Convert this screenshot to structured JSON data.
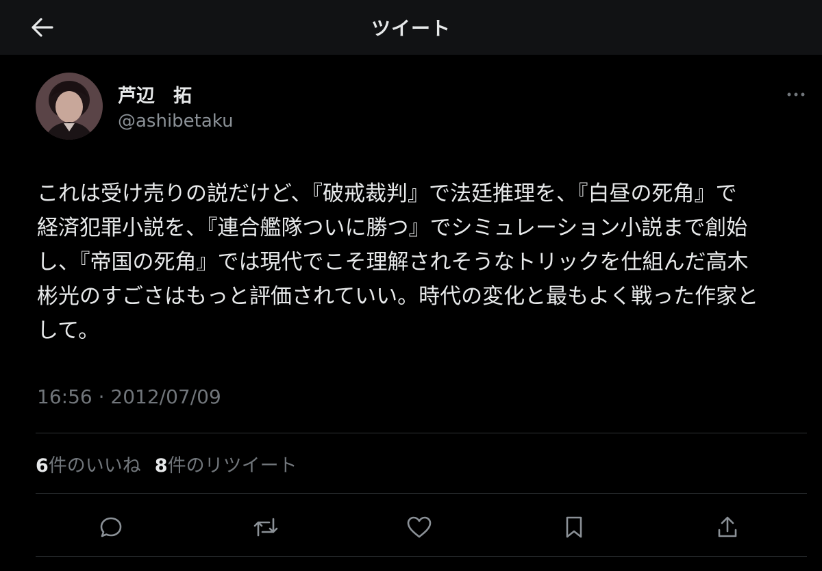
{
  "header": {
    "title": "ツイート",
    "back_icon": "arrow-left-icon"
  },
  "author": {
    "display_name": "芦辺　拓",
    "handle": "@ashibetaku",
    "avatar_icon": "avatar-photo"
  },
  "tweet": {
    "lines": [
      "これは受け売りの説だけど、『破戒裁判』で法廷推理を、『白昼の死角』で",
      "経済犯罪小説を、『連合艦隊ついに勝つ』でシミュレーション小説まで創始",
      "し、『帝国の死角』では現代でこそ理解されそうなトリックを仕組んだ高木",
      "彬光のすごさはもっと評価されていい。時代の変化と最もよく戦った作家と",
      "して。"
    ],
    "timestamp": "16:56 · 2012/07/09"
  },
  "stats": {
    "likes_count": "6",
    "likes_label": "件のいいね",
    "retweets_count": "8",
    "retweets_label": "件のリツイート"
  },
  "actions": [
    "reply-icon",
    "retweet-icon",
    "like-icon",
    "bookmark-icon",
    "share-icon"
  ],
  "colors": {
    "background": "#000000",
    "header_background": "#111214",
    "text": "#e7e9ea",
    "secondary_text": "#71767b",
    "divider": "#2f3336"
  }
}
